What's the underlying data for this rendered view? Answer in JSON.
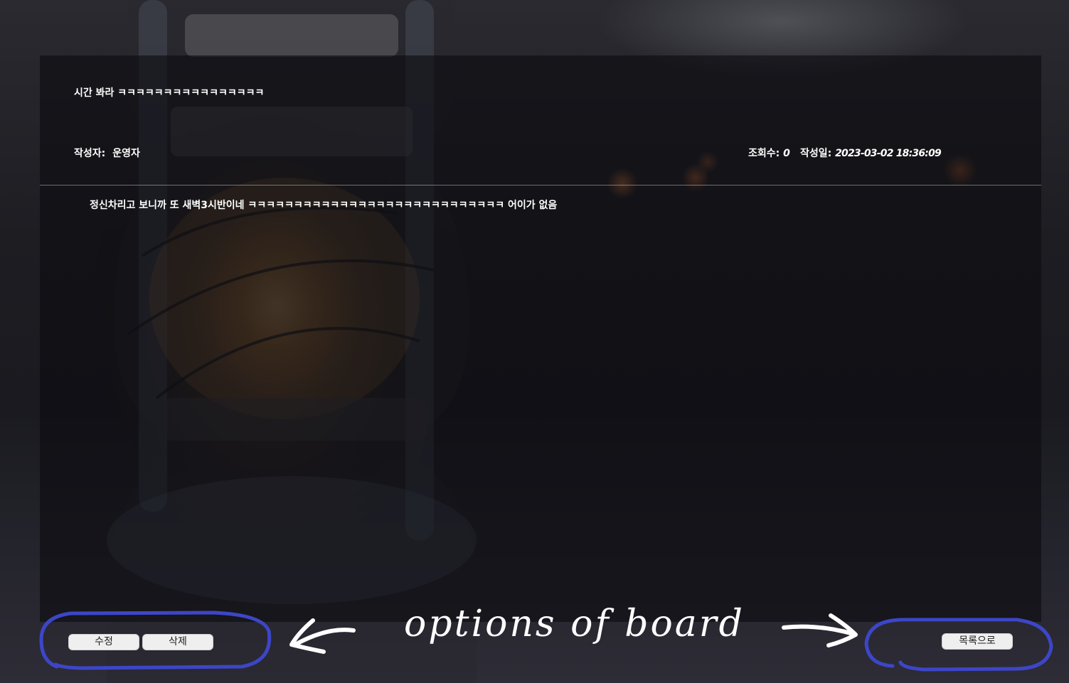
{
  "post": {
    "title": "시간 봐라 ㅋㅋㅋㅋㅋㅋㅋㅋㅋㅋㅋㅋㅋㅋㅋㅋ",
    "author_label": "작성자:",
    "author": "운영자",
    "views_label": "조회수:",
    "views": "0",
    "date_label": "작성일:",
    "date": "2023-03-02 18:36:09",
    "body": "정신차리고 보니까 또 새벽3시반이네 ㅋㅋㅋㅋㅋㅋㅋㅋㅋㅋㅋㅋㅋㅋㅋㅋㅋㅋㅋㅋㅋㅋㅋㅋㅋㅋㅋㅋ 어이가 없음"
  },
  "buttons": {
    "edit": "수정",
    "delete": "삭제",
    "list": "목록으로"
  },
  "annotation": {
    "text": "options of board",
    "color": "#3d46c8"
  }
}
